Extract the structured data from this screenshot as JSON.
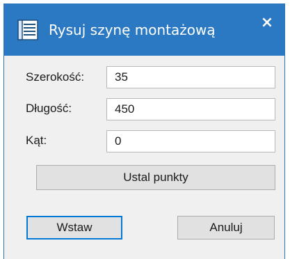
{
  "window": {
    "title": "Rysuj szynę montażową",
    "close_label": "×",
    "icon": "rail-list-icon",
    "accent_color": "#2b79c2"
  },
  "form": {
    "width": {
      "label": "Szerokość:",
      "value": "35"
    },
    "length": {
      "label": "Długość:",
      "value": "450"
    },
    "angle": {
      "label": "Kąt:",
      "value": "0"
    }
  },
  "buttons": {
    "set_points": "Ustal punkty",
    "insert": "Wstaw",
    "cancel": "Anuluj"
  }
}
